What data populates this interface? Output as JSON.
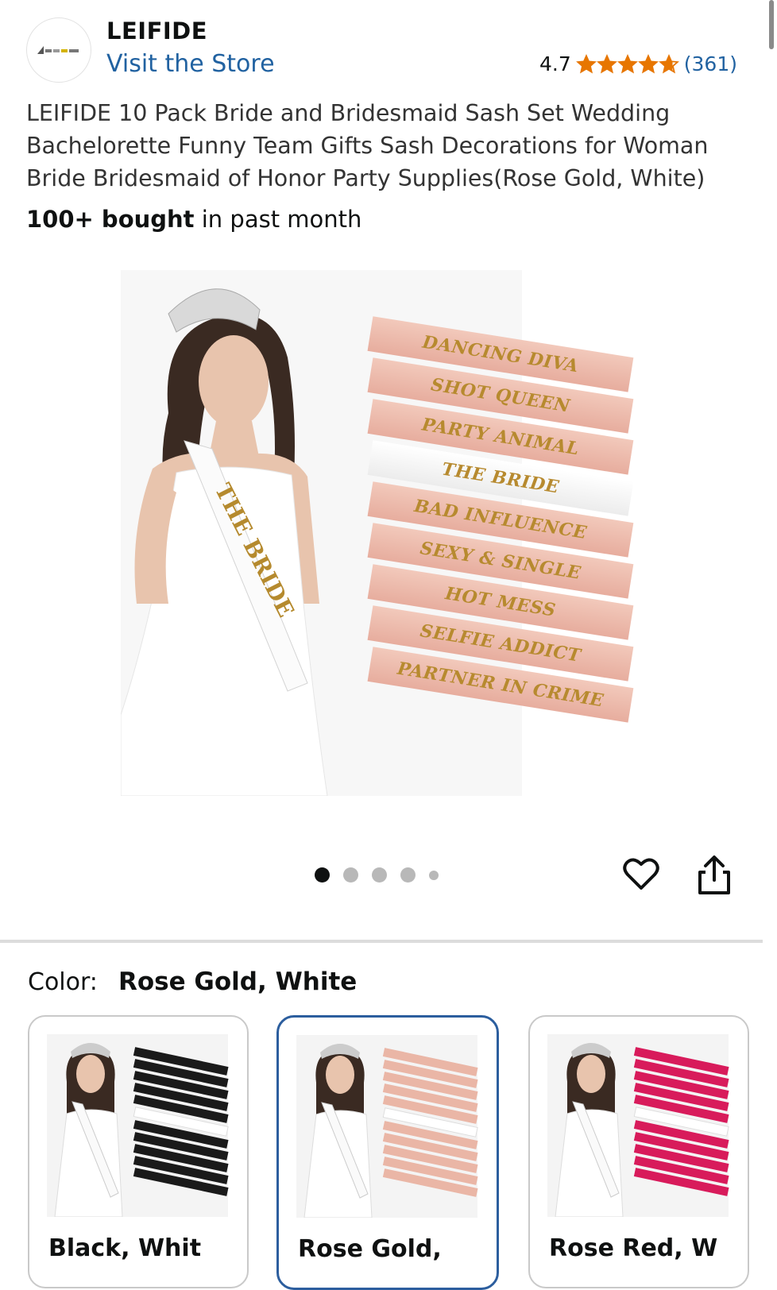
{
  "store": {
    "brand_name": "LEIFIDE",
    "link_text": "Visit the Store"
  },
  "rating": {
    "value": "4.7",
    "stars": 4.7,
    "count": "(361)",
    "star_color": "#e77600"
  },
  "product": {
    "title": "LEIFIDE 10 Pack Bride and Bridesmaid Sash Set Wedding Bachelorette Funny Team Gifts Sash Decorations for Woman Bride Bridesmaid of Honor Party Supplies(Rose Gold, White)",
    "bought_bold": "100+ bought",
    "bought_rest": " in past month"
  },
  "main_image": {
    "sashes": [
      "DANCING DIVA",
      "SHOT QUEEN",
      "PARTY ANIMAL",
      "THE BRIDE",
      "BAD INFLUENCE",
      "SEXY & SINGLE",
      "HOT MESS",
      "SELFIE ADDICT",
      "PARTNER IN CRIME"
    ],
    "model_sash": "THE BRIDE"
  },
  "pagination": {
    "total": 5,
    "active": 0
  },
  "actions": {
    "like_icon": "heart-icon",
    "share_icon": "share-icon"
  },
  "color": {
    "label": "Color:",
    "selected": "Rose Gold, White",
    "options": [
      {
        "name": "Black, Whit",
        "sash_color": "#1a1a1a"
      },
      {
        "name": "Rose Gold, ",
        "sash_color": "#eab6a6"
      },
      {
        "name": "Rose Red, W",
        "sash_color": "#d81b5b"
      }
    ]
  }
}
